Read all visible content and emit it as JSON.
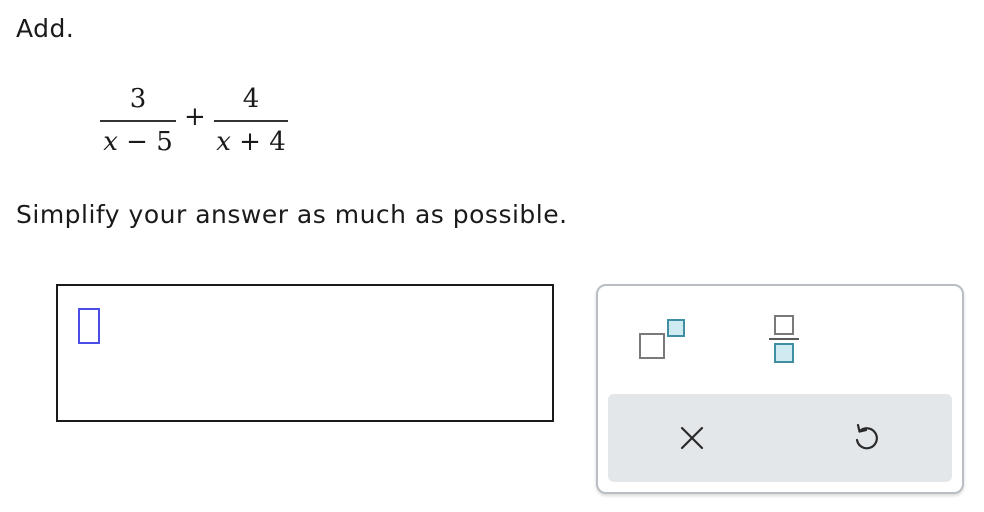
{
  "prompt": {
    "instruction": "Add."
  },
  "expression": {
    "term1": {
      "numerator": "3",
      "denominator_var": "x",
      "denominator_rest": " − 5"
    },
    "operator": "+",
    "term2": {
      "numerator": "4",
      "denominator_var": "x",
      "denominator_rest": " + 4"
    }
  },
  "simplify_text": "Simplify your answer as much as possible.",
  "answer": {
    "value": ""
  },
  "palette": {
    "tools": [
      {
        "name": "exponent",
        "icon": "superscript-icon"
      },
      {
        "name": "fraction",
        "icon": "fraction-icon"
      }
    ],
    "actions": [
      {
        "name": "clear",
        "icon": "close-icon"
      },
      {
        "name": "undo",
        "icon": "undo-icon"
      }
    ]
  },
  "colors": {
    "placeholder_border": "#4a4ee6",
    "icon_teal": "#3f8fa3",
    "icon_teal_fill": "#cfeaf1",
    "icon_gray": "#7a7a7a",
    "action_bar_bg": "#e3e7ea"
  }
}
